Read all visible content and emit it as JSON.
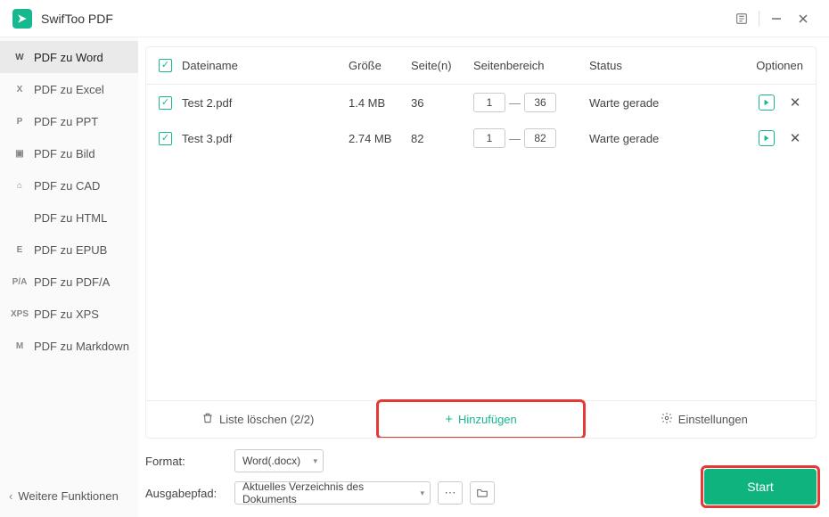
{
  "app": {
    "title": "SwifToo PDF"
  },
  "sidebar": {
    "items": [
      {
        "icon": "W",
        "label": "PDF zu Word",
        "active": true
      },
      {
        "icon": "X",
        "label": "PDF zu Excel"
      },
      {
        "icon": "P",
        "label": "PDF zu PPT"
      },
      {
        "icon": "▣",
        "label": "PDF zu Bild"
      },
      {
        "icon": "⌂",
        "label": "PDF zu CAD"
      },
      {
        "icon": "</>",
        "label": "PDF zu HTML"
      },
      {
        "icon": "E",
        "label": "PDF zu EPUB"
      },
      {
        "icon": "P/A",
        "label": "PDF zu PDF/A"
      },
      {
        "icon": "XPS",
        "label": "PDF zu XPS"
      },
      {
        "icon": "M",
        "label": "PDF zu Markdown"
      }
    ],
    "footer": "Weitere Funktionen"
  },
  "table": {
    "headers": {
      "name": "Dateiname",
      "size": "Größe",
      "pages": "Seite(n)",
      "range": "Seitenbereich",
      "status": "Status",
      "options": "Optionen"
    },
    "rows": [
      {
        "name": "Test 2.pdf",
        "size": "1.4 MB",
        "pages": "36",
        "from": "1",
        "to": "36",
        "status": "Warte gerade"
      },
      {
        "name": "Test 3.pdf",
        "size": "2.74 MB",
        "pages": "82",
        "from": "1",
        "to": "82",
        "status": "Warte gerade"
      }
    ]
  },
  "toolbar": {
    "clear": "Liste löschen (2/2)",
    "add": "Hinzufügen",
    "settings": "Einstellungen"
  },
  "footer": {
    "format_label": "Format:",
    "format_value": "Word(.docx)",
    "output_label": "Ausgabepfad:",
    "output_value": "Aktuelles Verzeichnis des Dokuments",
    "start": "Start"
  }
}
